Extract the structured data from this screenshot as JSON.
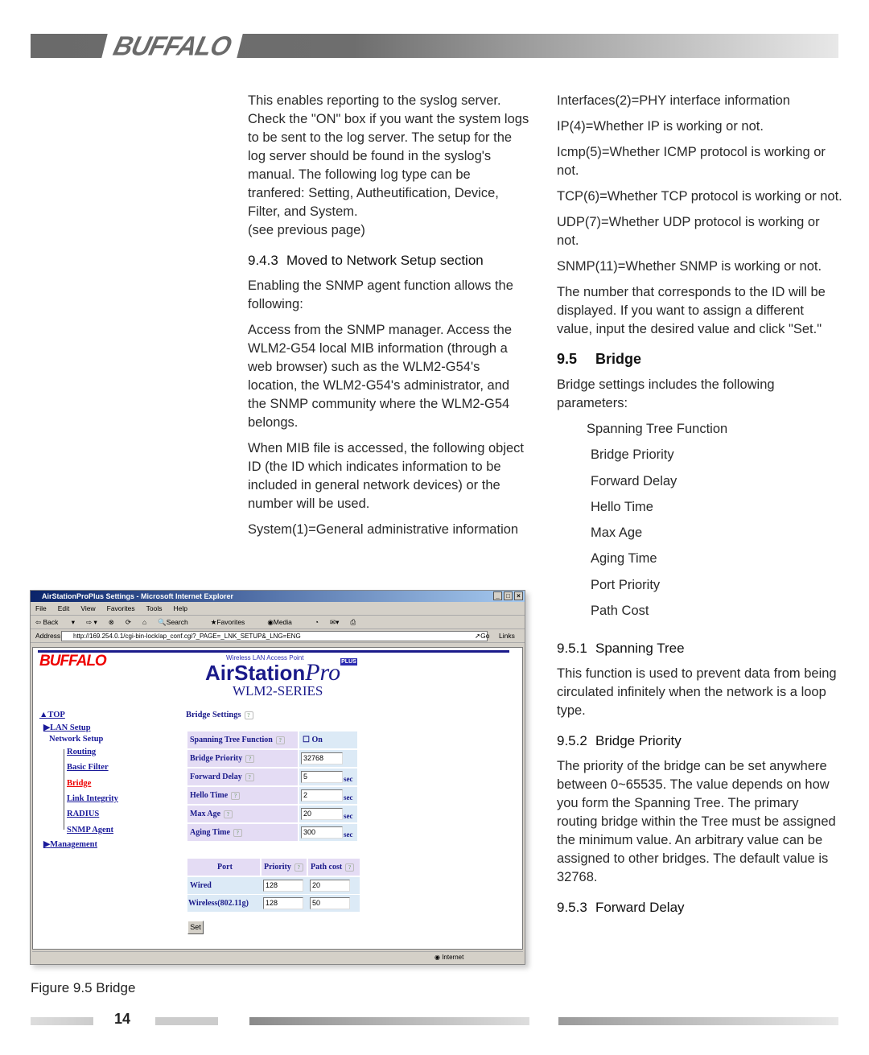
{
  "header": {
    "logo": "BUFFALO"
  },
  "left": {
    "p1": "This enables reporting to the syslog server. Check the \"ON\" box if you want the system logs to be sent to the log server. The setup for the log server should be found in the syslog's manual. The following log type can be tranfered: Setting, Autheutification, Device, Filter, and System.",
    "p1b": "(see previous page)",
    "h943_num": "9.4.3",
    "h943": "Moved to Network Setup section",
    "p2": "Enabling the SNMP agent function allows the following:",
    "p3": "Access from the SNMP manager. Access the WLM2-G54 local MIB information (through a web browser) such as the WLM2-G54's location, the WLM2-G54's administrator, and the SNMP community where the WLM2-G54 belongs.",
    "p4": "When MIB file is accessed, the following object ID (the ID which indicates information to be included in general network devices) or the number will be used.",
    "p5": "System(1)=General administrative information"
  },
  "right": {
    "ids": [
      "Interfaces(2)=PHY interface information",
      "IP(4)=Whether IP is working or not.",
      "Icmp(5)=Whether ICMP protocol is working or not.",
      "TCP(6)=Whether TCP protocol is working or not.",
      "UDP(7)=Whether UDP protocol is working or not.",
      "SNMP(11)=Whether SNMP is working or not."
    ],
    "p_id": "The number that corresponds to the ID will be displayed. If you want to assign a different value, input the desired value and click \"Set.\"",
    "h95_num": "9.5",
    "h95": "Bridge",
    "p95": "Bridge settings includes the following parameters:",
    "params": [
      "Spanning Tree Function",
      "Bridge Priority",
      "Forward Delay",
      "Hello Time",
      "Max Age",
      "Aging Time",
      "Port Priority",
      "Path Cost"
    ],
    "h951_num": "9.5.1",
    "h951": "Spanning Tree",
    "p951": "This function is used to prevent data from being circulated infinitely when the network is a loop type.",
    "h952_num": "9.5.2",
    "h952": "Bridge Priority",
    "p952": "The priority of the bridge can be set anywhere between 0~65535. The value depends on how you form the Spanning Tree. The primary routing bridge within the Tree must be assigned the minimum value. An arbitrary value can be assigned to other bridges. The default value is 32768.",
    "h953_num": "9.5.3",
    "h953": "Forward Delay"
  },
  "browser": {
    "title": "AirStationProPlus Settings - Microsoft Internet Explorer",
    "menu": [
      "File",
      "Edit",
      "View",
      "Favorites",
      "Tools",
      "Help"
    ],
    "toolbar": [
      "Back",
      "Search",
      "Favorites",
      "Media"
    ],
    "address_label": "Address",
    "address": "http://169.254.0.1/cgi-bin-lock/ap_conf.cgi?_PAGE=_LNK_SETUP&_LNG=ENG",
    "go": "Go",
    "links": "Links",
    "logo": "BUFFALO",
    "product_sub": "Wireless LAN Access Point",
    "product": "AirStation",
    "product_pro": "Pro",
    "product_plus": "PLUS",
    "series": "WLM2-SERIES",
    "nav": [
      "TOP",
      "LAN Setup",
      "Network Setup",
      "Routing",
      "Basic Filter",
      "Bridge",
      "Link Integrity",
      "RADIUS",
      "SNMP Agent",
      "Management"
    ],
    "section_title": "Bridge Settings",
    "rows": [
      {
        "label": "Spanning Tree Function",
        "value": "On"
      },
      {
        "label": "Bridge Priority",
        "value": "32768"
      },
      {
        "label": "Forward Delay",
        "value": "5",
        "unit": "sec"
      },
      {
        "label": "Hello Time",
        "value": "2",
        "unit": "sec"
      },
      {
        "label": "Max Age",
        "value": "20",
        "unit": "sec"
      },
      {
        "label": "Aging Time",
        "value": "300",
        "unit": "sec"
      }
    ],
    "port_headers": [
      "Port",
      "Priority",
      "Path cost"
    ],
    "ports": [
      {
        "name": "Wired",
        "priority": "128",
        "cost": "20"
      },
      {
        "name": "Wireless(802.11g)",
        "priority": "128",
        "cost": "50"
      }
    ],
    "set": "Set",
    "status": "Internet",
    "spanning_checked": false
  },
  "caption": "Figure 9.5  Bridge",
  "page_number": "14"
}
